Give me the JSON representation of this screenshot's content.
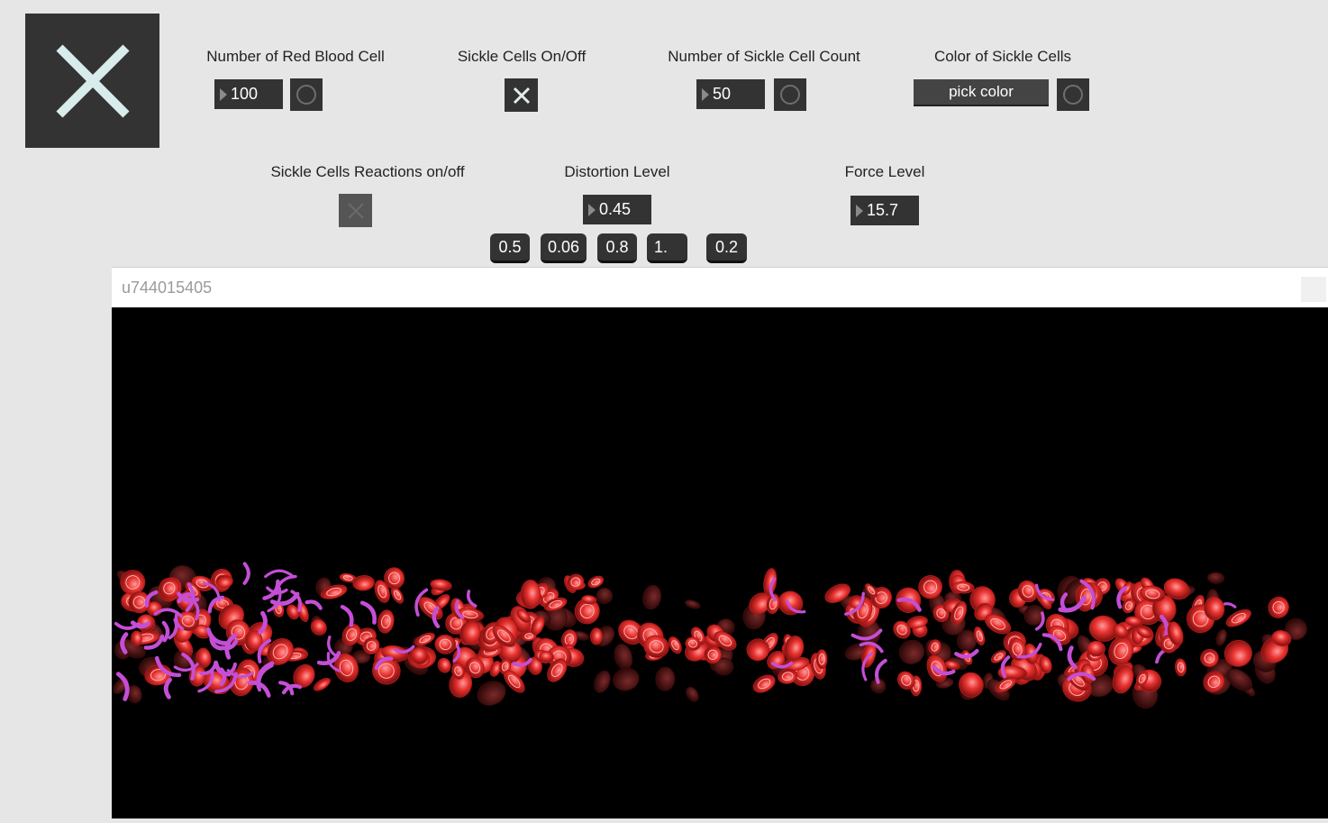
{
  "main_toggle": {
    "state": "on"
  },
  "controls": {
    "red_blood_cell": {
      "label": "Number of Red Blood Cell",
      "value": "100"
    },
    "sickle_on_off": {
      "label": "Sickle Cells On/Off",
      "state": "on"
    },
    "sickle_count": {
      "label": "Number of Sickle Cell Count",
      "value": "50"
    },
    "sickle_color": {
      "label": "Color of Sickle Cells",
      "button": "pick color"
    },
    "reactions": {
      "label": "Sickle Cells Reactions on/off",
      "state": "off"
    },
    "distortion": {
      "label": "Distortion Level",
      "value": "0.45"
    },
    "force": {
      "label": "Force Level",
      "value": "15.7"
    },
    "presets": [
      "0.5",
      "0.06",
      "0.8",
      "1.",
      "0.2"
    ]
  },
  "render_window": {
    "title": "u744015405",
    "background": "#000000",
    "cell_colors": {
      "red_blood_cell": "#e8322f",
      "sickle_cell": "#c44fd6"
    }
  }
}
